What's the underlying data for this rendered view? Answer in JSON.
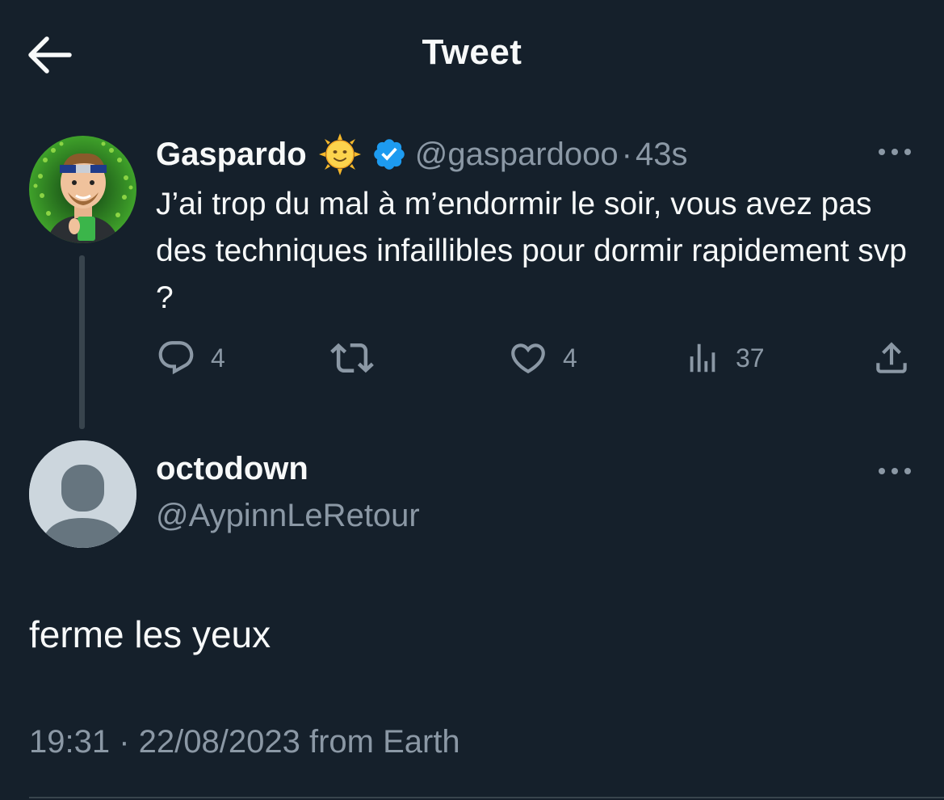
{
  "header": {
    "title": "Tweet",
    "back_icon": "arrow-left-icon"
  },
  "parent_tweet": {
    "author_name": "Gaspardo",
    "emoji_icon": "sun-with-face-icon",
    "verified_icon": "verified-badge-icon",
    "verified_color": "#1d9bf0",
    "handle": "@gaspardooo",
    "separator": "·",
    "time_ago": "43s",
    "more_icon": "more-dots-icon",
    "text": "J’ai trop du mal à m’endormir le soir, vous avez pas des techniques infaillibles pour dormir rapidement svp ?",
    "actions": {
      "reply": {
        "icon": "reply-icon",
        "count": "4"
      },
      "retweet": {
        "icon": "retweet-icon",
        "count": ""
      },
      "like": {
        "icon": "heart-icon",
        "count": "4"
      },
      "views": {
        "icon": "views-chart-icon",
        "count": "37"
      },
      "share": {
        "icon": "share-icon",
        "count": ""
      }
    }
  },
  "reply_tweet": {
    "author_name": "octodown",
    "handle": "@AypinnLeRetour",
    "more_icon": "more-dots-icon",
    "text": "ferme les yeux",
    "meta": "19:31 · 22/08/2023 from Earth"
  },
  "colors": {
    "background": "#15202b",
    "text_primary": "#f7f9f9",
    "text_secondary": "#8b98a5",
    "divider": "#38444d",
    "accent": "#1d9bf0"
  }
}
